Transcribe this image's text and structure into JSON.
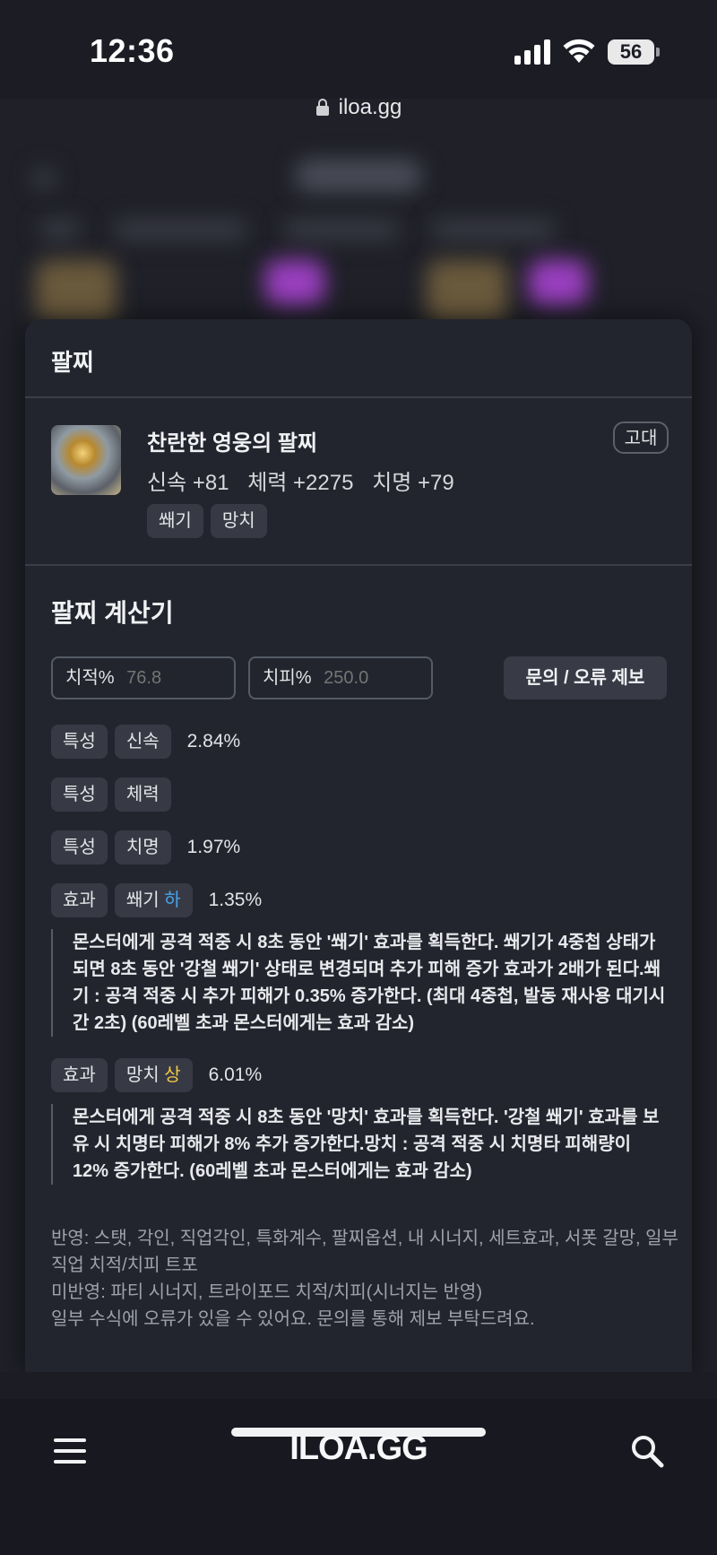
{
  "status_bar": {
    "time": "12:36",
    "battery": "56"
  },
  "browser": {
    "url": "iloa.gg"
  },
  "card": {
    "title": "팔찌",
    "item": {
      "name": "찬란한 영웅의 팔찌",
      "grade": "고대",
      "stats": [
        "신속 +81",
        "체력 +2275",
        "치명 +79"
      ],
      "tags": [
        "쐐기",
        "망치"
      ]
    },
    "calculator": {
      "title": "팔찌 계산기",
      "crit_rate_label": "치적%",
      "crit_rate_placeholder": "76.8",
      "crit_dmg_label": "치피%",
      "crit_dmg_placeholder": "250.0",
      "report_button": "문의 / 오류 제보",
      "rows": [
        {
          "kind": "특성",
          "name": "신속",
          "value": "2.84%"
        },
        {
          "kind": "특성",
          "name": "체력",
          "value": ""
        },
        {
          "kind": "특성",
          "name": "치명",
          "value": "1.97%"
        },
        {
          "kind": "효과",
          "name": "쐐기",
          "level": "하",
          "value": "1.35%",
          "description": "몬스터에게 공격 적중 시 8초 동안 '쐐기' 효과를 획득한다. 쐐기가 4중첩 상태가 되면 8초 동안 '강철 쐐기' 상태로 변경되며 추가 피해 증가 효과가 2배가 된다.쐐기 : 공격 적중 시 추가 피해가 0.35% 증가한다. (최대 4중첩, 발동 재사용 대기시간 2초) (60레벨 초과 몬스터에게는 효과 감소)"
        },
        {
          "kind": "효과",
          "name": "망치",
          "level": "상",
          "value": "6.01%",
          "description": "몬스터에게 공격 적중 시 8초 동안 '망치' 효과를 획득한다. '강철 쐐기' 효과를 보유 시 치명타 피해가 8% 추가 증가한다.망치 : 공격 적중 시 치명타 피해량이 12% 증가한다. (60레벨 초과 몬스터에게는 효과 감소)"
        }
      ],
      "notes": [
        "반영: 스탯, 각인, 직업각인, 특화계수, 팔찌옵션, 내 시너지, 세트효과, 서폿 갈망, 일부 직업 치적/치피 트포",
        "미반영: 파티 시너지, 트라이포드 치적/치피(시너지는 반영)",
        "일부 수식에 오류가 있을 수 있어요. 문의를 통해 제보 부탁드려요."
      ]
    }
  },
  "bottom_nav": {
    "logo": "ILOA.GG"
  },
  "colors": {
    "background": "#1f2028",
    "card": "#23252e",
    "chip": "#373a45",
    "level_low": "#45a6f0",
    "level_high": "#f3c847"
  }
}
